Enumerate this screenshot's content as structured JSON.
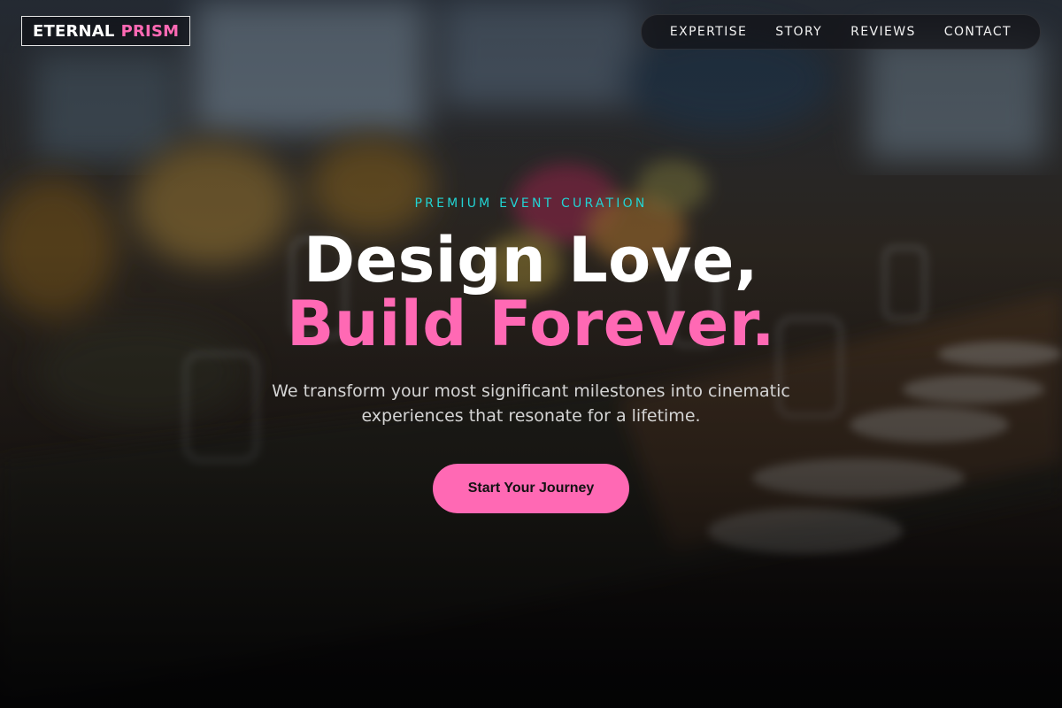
{
  "brand": {
    "word1": "ETERNAL",
    "word2": "PRISM",
    "accent_color": "#ff69b4"
  },
  "nav": {
    "items": [
      "EXPERTISE",
      "STORY",
      "REVIEWS",
      "CONTACT"
    ]
  },
  "hero": {
    "eyebrow": "PREMIUM EVENT CURATION",
    "eyebrow_color": "#22d3d3",
    "title_line1": "Design Love,",
    "title_line2": "Build Forever.",
    "subtitle": "We transform your most significant milestones into cinematic experiences that resonate for a lifetime.",
    "cta_label": "Start Your Journey"
  }
}
